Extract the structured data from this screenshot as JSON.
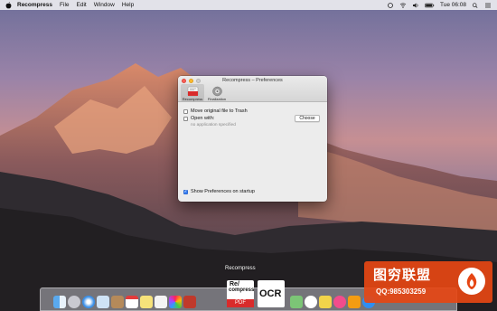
{
  "menubar": {
    "app": "Recompress",
    "items": [
      "File",
      "Edit",
      "Window",
      "Help"
    ],
    "clock": "Tue 06:08"
  },
  "window": {
    "title": "Recompress – Preferences",
    "tabs": [
      {
        "label": "Recompress",
        "icon": "recompress-app-icon",
        "selected": true
      },
      {
        "label": "Finalization",
        "icon": "finalization-gear-icon",
        "selected": false
      }
    ],
    "options": {
      "move_to_trash": {
        "label": "Move original file to Trash",
        "checked": false
      },
      "open_with": {
        "label": "Open with:",
        "checked": false,
        "app_note": "no application specified"
      },
      "choose_button": "Choose",
      "show_prefs": {
        "label": "Show Preferences on startup",
        "checked": true
      }
    }
  },
  "dock": {
    "hover_label": "Recompress",
    "big_tiles": [
      {
        "line1": "Re/",
        "line2": "compress",
        "line3": "PDF"
      },
      {
        "line1": "OCR"
      }
    ]
  },
  "watermark": {
    "title": "图穷联盟",
    "qq": "QQ:985303259"
  },
  "colors": {
    "accent": "#3b82f6",
    "close": "#fc5f57",
    "minimize": "#fdbc2e",
    "watermark": "#e64614"
  }
}
